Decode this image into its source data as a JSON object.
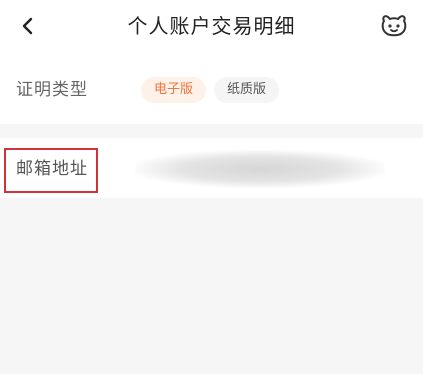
{
  "header": {
    "title": "个人账户交易明细"
  },
  "icons": {
    "back": "chevron-left-icon",
    "service": "customer-service-icon"
  },
  "certificate_type": {
    "label": "证明类型",
    "options": [
      {
        "label": "电子版",
        "selected": true
      },
      {
        "label": "纸质版",
        "selected": false
      }
    ]
  },
  "email": {
    "label": "邮箱地址",
    "value_obscured": true
  },
  "colors": {
    "accent": "#f0763a",
    "accent_bg": "#fdf1ea",
    "highlight_box": "#d0313a"
  }
}
